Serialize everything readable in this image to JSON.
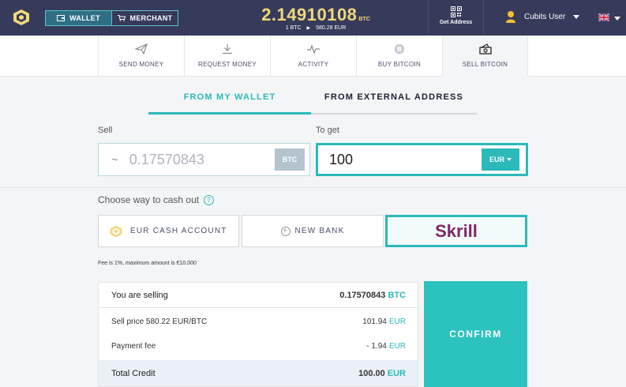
{
  "header": {
    "tabs": [
      {
        "label": "WALLET",
        "icon": "wallet-icon"
      },
      {
        "label": "MERCHANT",
        "icon": "cart-icon"
      }
    ],
    "balance": "2.14910108",
    "balance_unit": "BTC",
    "rate_left": "1 BTC",
    "rate_right": "580.28 EUR",
    "get_address_label": "Get Address",
    "user_name": "Cubits User",
    "colors": {
      "bar": "#363a5b",
      "accent": "#2bb9b9",
      "balance": "#f1d87a"
    }
  },
  "actions": [
    {
      "label": "SEND MONEY",
      "icon": "paper-plane-icon"
    },
    {
      "label": "REQUEST MONEY",
      "icon": "download-icon"
    },
    {
      "label": "ACTIVITY",
      "icon": "pulse-icon"
    },
    {
      "label": "BUY BITCOIN",
      "icon": "bitcoin-icon"
    },
    {
      "label": "SELL BITCOIN",
      "icon": "cash-icon"
    }
  ],
  "tabs": {
    "from_wallet": "FROM MY WALLET",
    "from_external": "FROM EXTERNAL ADDRESS"
  },
  "form": {
    "sell_label": "Sell",
    "sell_prefix": "~",
    "sell_value": "0.17570843",
    "sell_unit": "BTC",
    "get_label": "To get",
    "get_value": "100",
    "get_unit": "EUR"
  },
  "cashout": {
    "title": "Choose way to cash out",
    "help": "?",
    "methods": [
      "EUR CASH ACCOUNT",
      "NEW BANK",
      "Skrill"
    ],
    "fee_note": "Fee is 1%, maximum amount is €10.000"
  },
  "summary": {
    "selling_label": "You are selling",
    "selling_value": "0.17570843",
    "selling_unit": "BTC",
    "price_label": "Sell price 580.22 EUR/BTC",
    "price_value": "101.94",
    "price_unit": "EUR",
    "fee_label": "Payment fee",
    "fee_value": "- 1.94",
    "fee_unit": "EUR",
    "total_label": "Total Credit",
    "total_value": "100.00",
    "total_unit": "EUR"
  },
  "confirm_label": "CONFIRM"
}
